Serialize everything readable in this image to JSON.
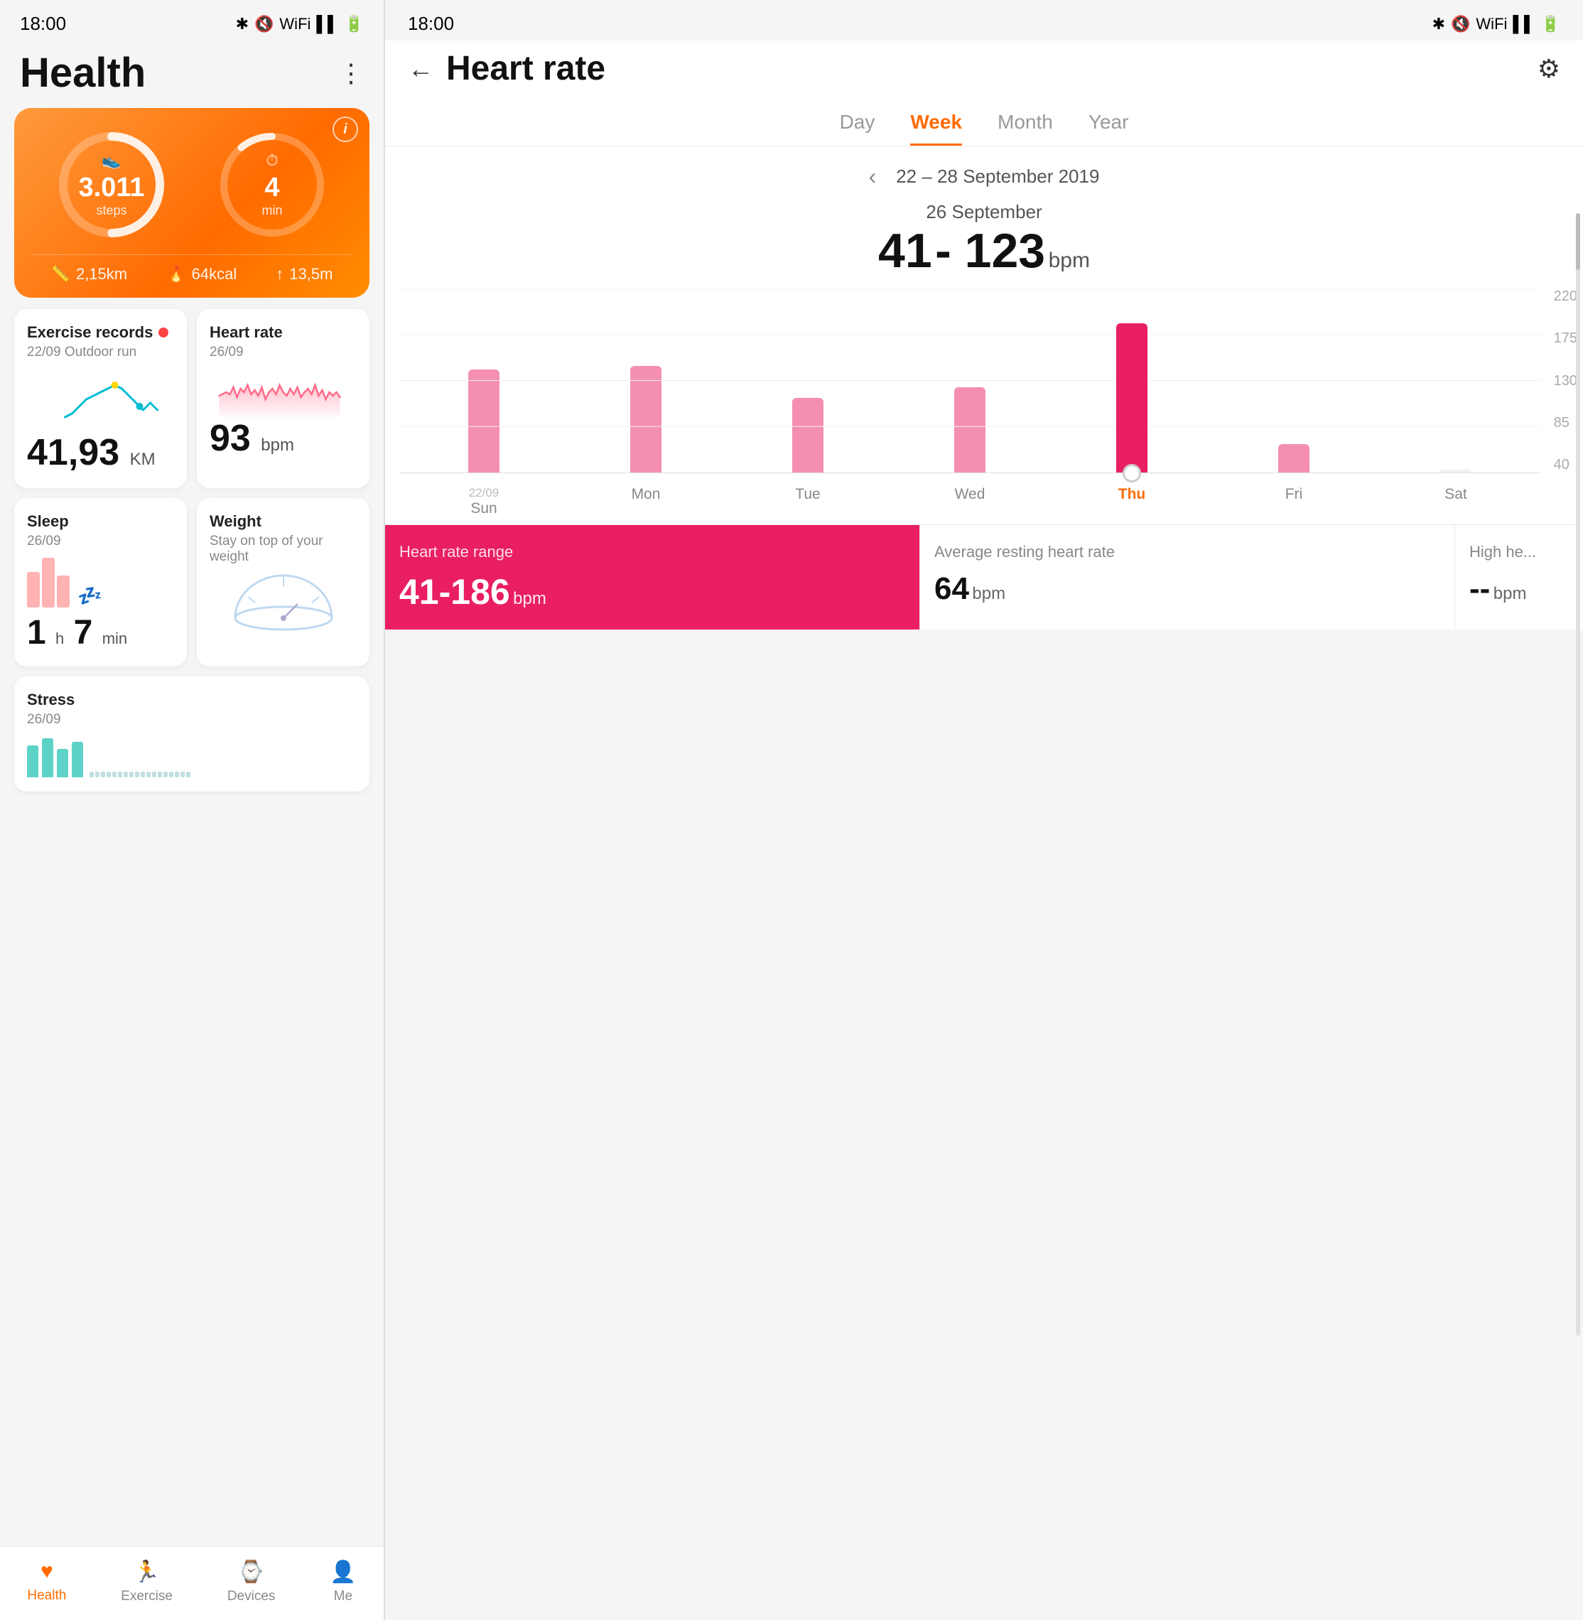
{
  "left": {
    "statusBar": {
      "time": "18:00",
      "icons": "🔵 🔇 📶 📶 🔋"
    },
    "appTitle": "Health",
    "menuIcon": "⋮",
    "activityCard": {
      "steps": {
        "value": "3.011",
        "label": "steps",
        "icon": "👟"
      },
      "active": {
        "value": "4",
        "label": "min",
        "icon": "⏱"
      },
      "stats": [
        {
          "icon": "📏",
          "value": "2,15km"
        },
        {
          "icon": "🔥",
          "value": "64kcal"
        },
        {
          "icon": "🏃",
          "value": "13,5m"
        }
      ],
      "infoIcon": "i"
    },
    "dashCards": [
      {
        "id": "exercise",
        "title": "Exercise records",
        "hasDot": true,
        "sub": "22/09 Outdoor run",
        "value": "41,93",
        "unit": "KM"
      },
      {
        "id": "heartrate",
        "title": "Heart rate",
        "hasDot": false,
        "sub": "26/09",
        "value": "93",
        "unit": "bpm"
      },
      {
        "id": "sleep",
        "title": "Sleep",
        "hasDot": false,
        "sub": "26/09",
        "value": "1",
        "valueB": "7",
        "unit": "h",
        "unitB": "min"
      },
      {
        "id": "weight",
        "title": "Weight",
        "hasDot": false,
        "sub": "Stay on top of your weight",
        "value": "",
        "unit": ""
      }
    ],
    "stressCard": {
      "title": "Stress",
      "sub": "26/09"
    },
    "bottomNav": [
      {
        "id": "health",
        "icon": "❤️",
        "label": "Health",
        "active": true
      },
      {
        "id": "exercise",
        "icon": "🏃",
        "label": "Exercise",
        "active": false
      },
      {
        "id": "devices",
        "icon": "⌚",
        "label": "Devices",
        "active": false
      },
      {
        "id": "me",
        "icon": "👤",
        "label": "Me",
        "active": false
      }
    ]
  },
  "right": {
    "statusBar": {
      "time": "18:00"
    },
    "header": {
      "title": "Heart rate",
      "backLabel": "←",
      "gearLabel": "⚙"
    },
    "tabs": [
      {
        "id": "day",
        "label": "Day",
        "active": false
      },
      {
        "id": "week",
        "label": "Week",
        "active": true
      },
      {
        "id": "month",
        "label": "Month",
        "active": false
      },
      {
        "id": "year",
        "label": "Year",
        "active": false
      }
    ],
    "dateNav": {
      "prevArrow": "‹",
      "range": "22 – 28 September 2019"
    },
    "selectedDate": {
      "label": "26 September",
      "bpmMin": "41",
      "dash": " - ",
      "bpmMax": "123",
      "unit": "bpm"
    },
    "chart": {
      "yLabels": [
        "220",
        "175",
        "130",
        "85",
        "40"
      ],
      "bars": [
        {
          "day": "Sun",
          "date": "22/09",
          "minH": 140,
          "maxH": 200,
          "selected": false
        },
        {
          "day": "Mon",
          "date": "",
          "minH": 100,
          "maxH": 190,
          "selected": false
        },
        {
          "day": "Tue",
          "date": "",
          "minH": 80,
          "maxH": 160,
          "selected": false
        },
        {
          "day": "Wed",
          "date": "",
          "minH": 70,
          "maxH": 130,
          "selected": false
        },
        {
          "day": "Thu",
          "date": "",
          "minH": 50,
          "maxH": 210,
          "selected": true
        },
        {
          "day": "Fri",
          "date": "",
          "minH": 20,
          "maxH": 60,
          "selected": false
        },
        {
          "day": "Sat",
          "date": "",
          "minH": 0,
          "maxH": 0,
          "selected": false
        }
      ]
    },
    "summaryCards": [
      {
        "id": "range",
        "highlighted": true,
        "title": "Heart rate range",
        "value": "41-186",
        "unit": "bpm"
      },
      {
        "id": "resting",
        "highlighted": false,
        "title": "Average resting heart rate",
        "value": "64",
        "unit": "bpm"
      },
      {
        "id": "high",
        "highlighted": false,
        "title": "High he...",
        "value": "--",
        "unit": "bpm"
      }
    ]
  }
}
